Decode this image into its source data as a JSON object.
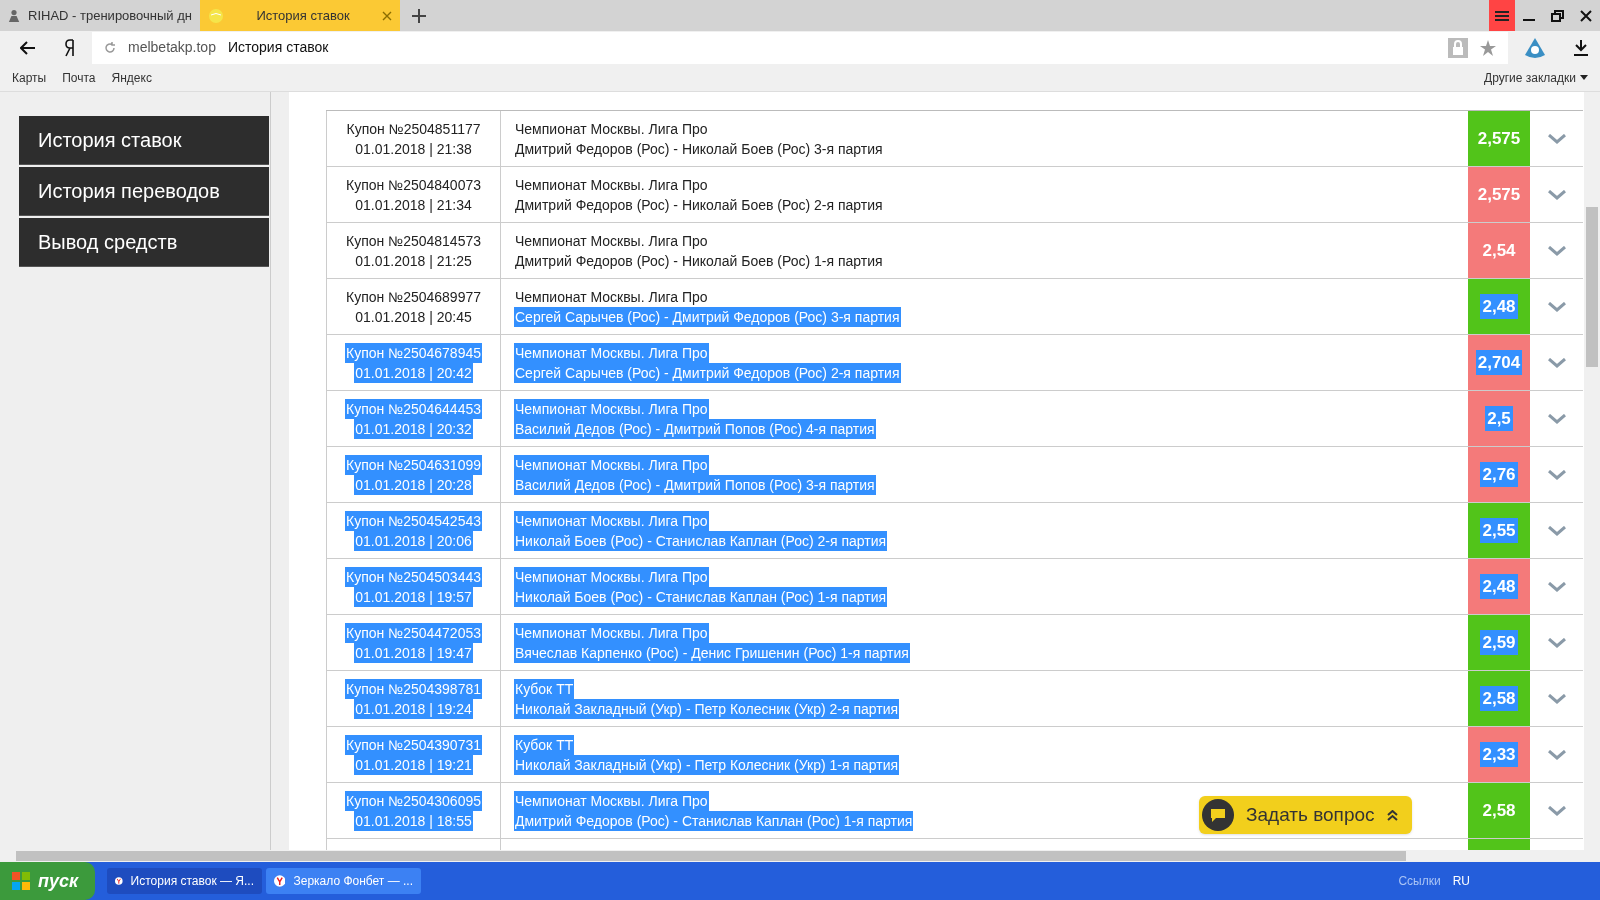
{
  "browser": {
    "tabs": [
      {
        "label": "RIHAD - тренировочный дн",
        "selected": false
      },
      {
        "label": "История ставок",
        "selected": true
      }
    ],
    "address": {
      "domain": "melbetakp.top",
      "title": "История ставок"
    },
    "bookmarks": [
      "Карты",
      "Почта",
      "Яндекс"
    ],
    "other_bookmarks": "Другие закладки"
  },
  "sidebar": {
    "items": [
      {
        "label": "История ставок"
      },
      {
        "label": "История переводов"
      },
      {
        "label": "Вывод средств"
      }
    ]
  },
  "bets": [
    {
      "coupon": {
        "text": "Купон №2504851177",
        "highlighted": false
      },
      "date": {
        "text": "01.01.2018 | 21:38",
        "highlighted": false
      },
      "league": {
        "text": "Чемпионат Москвы. Лига Про",
        "highlighted": false
      },
      "match": {
        "text": "Дмитрий Федоров (Рос) - Николай Боев (Рос) 3-я партия",
        "highlighted": false
      },
      "odds": {
        "text": "2,575",
        "highlighted": false,
        "color": "#52c41a"
      }
    },
    {
      "coupon": {
        "text": "Купон №2504840073",
        "highlighted": false
      },
      "date": {
        "text": "01.01.2018 | 21:34",
        "highlighted": false
      },
      "league": {
        "text": "Чемпионат Москвы. Лига Про",
        "highlighted": false
      },
      "match": {
        "text": "Дмитрий Федоров (Рос) - Николай Боев (Рос) 2-я партия",
        "highlighted": false
      },
      "odds": {
        "text": "2,575",
        "highlighted": false,
        "color": "#f47a7a"
      }
    },
    {
      "coupon": {
        "text": "Купон №2504814573",
        "highlighted": false
      },
      "date": {
        "text": "01.01.2018 | 21:25",
        "highlighted": false
      },
      "league": {
        "text": "Чемпионат Москвы. Лига Про",
        "highlighted": false
      },
      "match": {
        "text": "Дмитрий Федоров (Рос) - Николай Боев (Рос) 1-я партия",
        "highlighted": false
      },
      "odds": {
        "text": "2,54",
        "highlighted": false,
        "color": "#f47a7a"
      }
    },
    {
      "coupon": {
        "text": "Купон №2504689977",
        "highlighted": false
      },
      "date": {
        "text": "01.01.2018 | 20:45",
        "highlighted": false
      },
      "league": {
        "text": "Чемпионат Москвы. Лига Про",
        "highlighted": false
      },
      "match": {
        "text": "Сергей Сарычев (Рос) - Дмитрий Федоров (Рос) 3-я партия",
        "highlighted": true
      },
      "odds": {
        "text": "2,48",
        "highlighted": true,
        "color": "#52c41a"
      }
    },
    {
      "coupon": {
        "text": "Купон №2504678945",
        "highlighted": true
      },
      "date": {
        "text": "01.01.2018 | 20:42",
        "highlighted": true
      },
      "league": {
        "text": "Чемпионат Москвы. Лига Про",
        "highlighted": true
      },
      "match": {
        "text": "Сергей Сарычев (Рос) - Дмитрий Федоров (Рос) 2-я партия",
        "highlighted": true
      },
      "odds": {
        "text": "2,704",
        "highlighted": true,
        "color": "#f47a7a"
      }
    },
    {
      "coupon": {
        "text": "Купон №2504644453",
        "highlighted": true
      },
      "date": {
        "text": "01.01.2018 | 20:32",
        "highlighted": true
      },
      "league": {
        "text": "Чемпионат Москвы. Лига Про",
        "highlighted": true
      },
      "match": {
        "text": "Василий Дедов (Рос) - Дмитрий Попов (Рос) 4-я партия",
        "highlighted": true
      },
      "odds": {
        "text": "2,5",
        "highlighted": true,
        "color": "#f47a7a"
      }
    },
    {
      "coupon": {
        "text": "Купон №2504631099",
        "highlighted": true
      },
      "date": {
        "text": "01.01.2018 | 20:28",
        "highlighted": true
      },
      "league": {
        "text": "Чемпионат Москвы. Лига Про",
        "highlighted": true
      },
      "match": {
        "text": "Василий Дедов (Рос) - Дмитрий Попов (Рос) 3-я партия",
        "highlighted": true
      },
      "odds": {
        "text": "2,76",
        "highlighted": true,
        "color": "#f47a7a"
      }
    },
    {
      "coupon": {
        "text": "Купон №2504542543",
        "highlighted": true
      },
      "date": {
        "text": "01.01.2018 | 20:06",
        "highlighted": true
      },
      "league": {
        "text": "Чемпионат Москвы. Лига Про",
        "highlighted": true
      },
      "match": {
        "text": "Николай Боев (Рос) - Станислав Каплан (Рос) 2-я партия",
        "highlighted": true
      },
      "odds": {
        "text": "2,55",
        "highlighted": true,
        "color": "#52c41a"
      }
    },
    {
      "coupon": {
        "text": "Купон №2504503443",
        "highlighted": true
      },
      "date": {
        "text": "01.01.2018 | 19:57",
        "highlighted": true
      },
      "league": {
        "text": "Чемпионат Москвы. Лига Про",
        "highlighted": true
      },
      "match": {
        "text": "Николай Боев (Рос) - Станислав Каплан (Рос) 1-я партия",
        "highlighted": true
      },
      "odds": {
        "text": "2,48",
        "highlighted": true,
        "color": "#f47a7a"
      }
    },
    {
      "coupon": {
        "text": "Купон №2504472053",
        "highlighted": true
      },
      "date": {
        "text": "01.01.2018 | 19:47",
        "highlighted": true
      },
      "league": {
        "text": "Чемпионат Москвы. Лига Про",
        "highlighted": true
      },
      "match": {
        "text": "Вячеслав Карпенко (Рос) - Денис Гришенин (Рос) 1-я партия",
        "highlighted": true
      },
      "odds": {
        "text": "2,59",
        "highlighted": true,
        "color": "#52c41a"
      }
    },
    {
      "coupon": {
        "text": "Купон №2504398781",
        "highlighted": true
      },
      "date": {
        "text": "01.01.2018 | 19:24",
        "highlighted": true
      },
      "league": {
        "text": "Кубок ТТ",
        "highlighted": true
      },
      "match": {
        "text": "Николай Закладный (Укр) - Петр Колесник (Укр) 2-я партия",
        "highlighted": true
      },
      "odds": {
        "text": "2,58",
        "highlighted": true,
        "color": "#52c41a"
      }
    },
    {
      "coupon": {
        "text": "Купон №2504390731",
        "highlighted": true
      },
      "date": {
        "text": "01.01.2018 | 19:21",
        "highlighted": true
      },
      "league": {
        "text": "Кубок ТТ",
        "highlighted": true
      },
      "match": {
        "text": "Николай Закладный (Укр) - Петр Колесник (Укр) 1-я партия",
        "highlighted": true
      },
      "odds": {
        "text": "2,33",
        "highlighted": true,
        "color": "#f47a7a"
      }
    },
    {
      "coupon": {
        "text": "Купон №2504306095",
        "highlighted": true
      },
      "date": {
        "text": "01.01.2018 | 18:55",
        "highlighted": true
      },
      "league": {
        "text": "Чемпионат Москвы. Лига Про",
        "highlighted": true
      },
      "match": {
        "text": "Дмитрий Федоров (Рос) - Станислав Каплан (Рос) 1-я партия",
        "highlighted": true
      },
      "odds": {
        "text": "2,58",
        "highlighted": false,
        "color": "#52c41a"
      }
    }
  ],
  "chat_button": {
    "label": "Задать вопрос"
  },
  "taskbar": {
    "start": "пуск",
    "windows": [
      {
        "label": "История ставок — Я...",
        "selected": true
      },
      {
        "label": "Зеркало Фонбет — ...",
        "selected": false
      }
    ],
    "links": "Ссылки",
    "language": "RU"
  }
}
